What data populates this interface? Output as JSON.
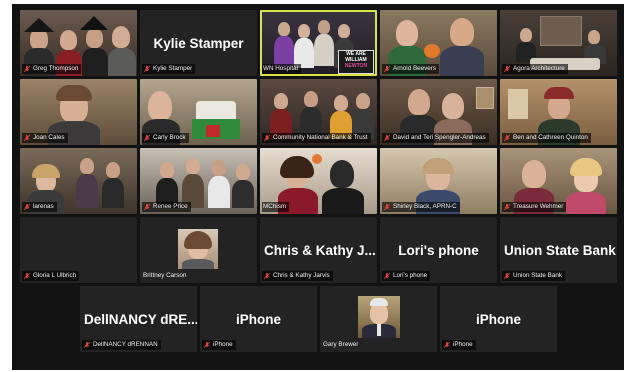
{
  "participants": [
    {
      "name": "Greg Thompson"
    },
    {
      "name": "Kylie Stamper",
      "display": "Kylie Stamper"
    },
    {
      "name": "WN Hospital"
    },
    {
      "name": "Arnold Beevers"
    },
    {
      "name": "Agora Architecture"
    },
    {
      "name": "Joan Cales"
    },
    {
      "name": "Carly Brock"
    },
    {
      "name": "Community National Bank & Trust"
    },
    {
      "name": "David and Teri Spengler-Andreas"
    },
    {
      "name": "Ben and Cathreen Quinton"
    },
    {
      "name": "larenas"
    },
    {
      "name": "Renee Price"
    },
    {
      "name": "MChism"
    },
    {
      "name": "Shirley Black, APRN-C"
    },
    {
      "name": "Treasure Wehmer"
    },
    {
      "name": "Gloria L Ulbrich"
    },
    {
      "name": "Brittney Carson"
    },
    {
      "name": "Chris & Kathy Jarvis",
      "display": "Chris & Kathy J..."
    },
    {
      "name": "Lori's phone",
      "display": "Lori's phone"
    },
    {
      "name": "Union State Bank",
      "display": "Union State Bank"
    },
    {
      "name": "DellNANCY dRENNAN",
      "display": "DellNANCY dRE..."
    },
    {
      "name": "iPhone",
      "display": "iPhone"
    },
    {
      "name": "Gary Brewer"
    },
    {
      "name": "iPhone",
      "display": "iPhone"
    }
  ],
  "signs": {
    "we_are": "WE ARE",
    "william": "WILLIAM",
    "newton": "NEWTON"
  },
  "colors": {
    "background": "#121212",
    "tile_blank": "#232323",
    "active_border": "#d7e34a",
    "muted_icon": "#e0453a"
  },
  "icons": {
    "muted": "muted-mic-icon"
  }
}
